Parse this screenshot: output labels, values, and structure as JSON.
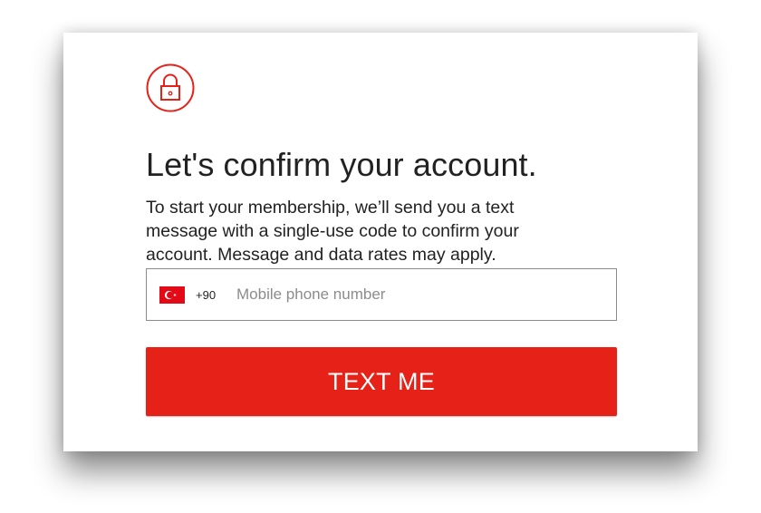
{
  "header": {
    "icon": "lock-icon",
    "title": "Let's confirm your account."
  },
  "description": "To start your membership, we’ll send you a text message with a single-use code to confirm your account. Message and data rates may apply.",
  "phone": {
    "country_flag_icon": "turkey-flag-icon",
    "country_code": "+90",
    "placeholder": "Mobile phone number",
    "value": ""
  },
  "submit": {
    "label": "TEXT ME"
  },
  "colors": {
    "accent": "#e62117",
    "text": "#222222",
    "placeholder": "#8c8c8c",
    "border": "#8c8c8c"
  }
}
